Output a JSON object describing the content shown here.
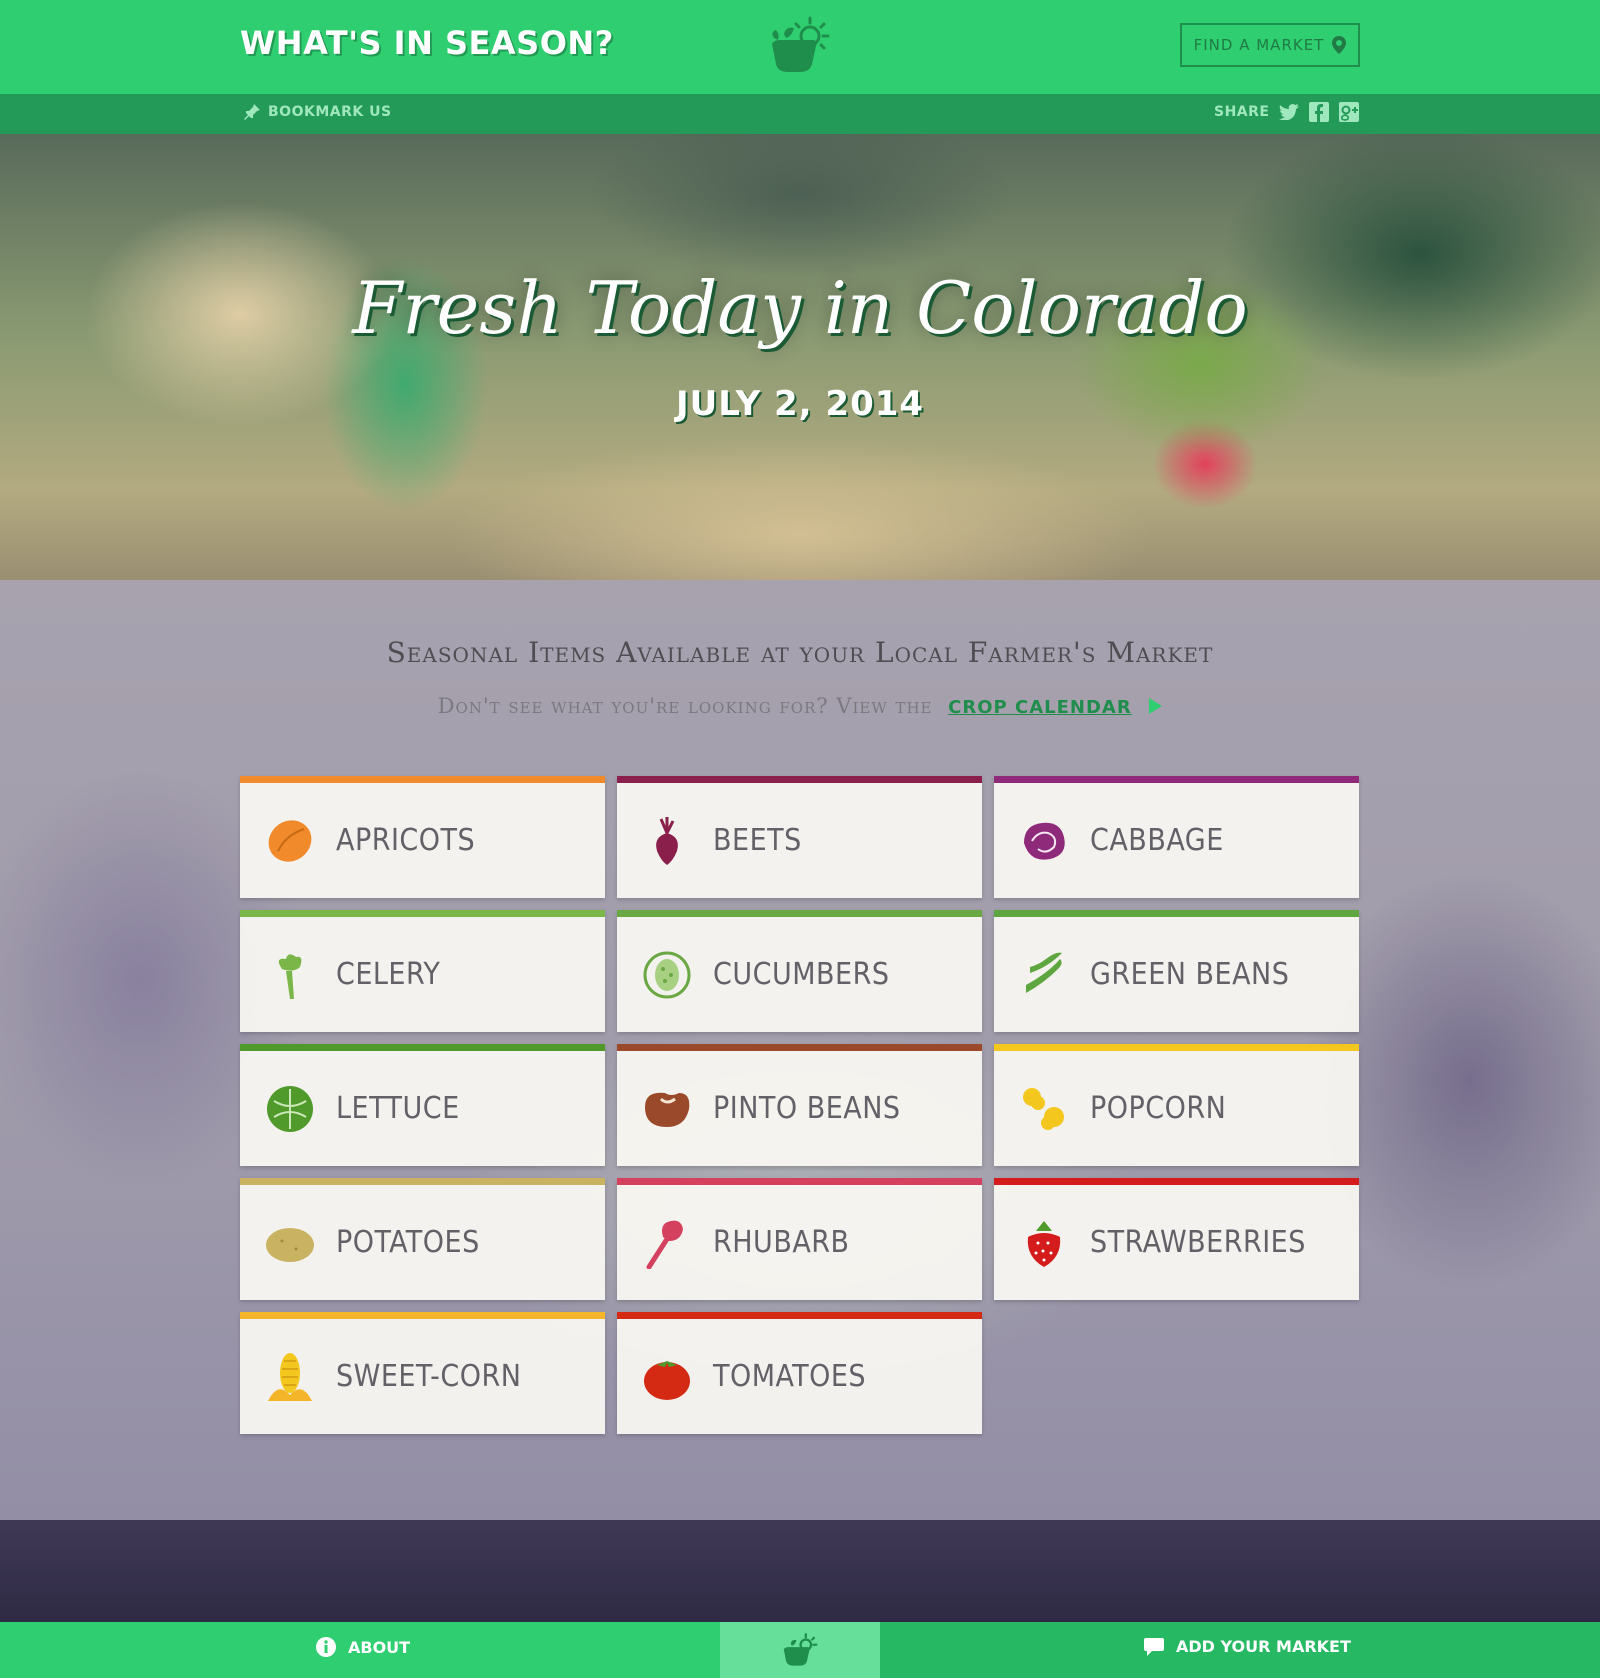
{
  "header": {
    "brand": "WHAT'S IN SEASON?",
    "find_market_label": "FIND A MARKET",
    "bookmark_label": "BOOKMARK US",
    "share_label": "SHARE"
  },
  "hero": {
    "title": "Fresh Today in Colorado",
    "date": "JULY 2, 2014"
  },
  "section": {
    "title": "Seasonal Items Available at your Local Farmer's Market",
    "subtitle": "Don't see what you're looking for? View the",
    "link_label": "CROP CALENDAR"
  },
  "items": [
    {
      "label": "APRICOTS",
      "color": "#f08a2a",
      "icon": "apricot-icon"
    },
    {
      "label": "BEETS",
      "color": "#8a1f4b",
      "icon": "beet-icon"
    },
    {
      "label": "CABBAGE",
      "color": "#8f2a7a",
      "icon": "cabbage-icon"
    },
    {
      "label": "CELERY",
      "color": "#7ab648",
      "icon": "celery-icon"
    },
    {
      "label": "CUCUMBERS",
      "color": "#6aa843",
      "icon": "cucumber-icon"
    },
    {
      "label": "GREEN BEANS",
      "color": "#5ea640",
      "icon": "green-beans-icon"
    },
    {
      "label": "LETTUCE",
      "color": "#4f9a2a",
      "icon": "lettuce-icon"
    },
    {
      "label": "PINTO BEANS",
      "color": "#9a4a2a",
      "icon": "pinto-beans-icon"
    },
    {
      "label": "POPCORN",
      "color": "#f4c71e",
      "icon": "popcorn-icon"
    },
    {
      "label": "POTATOES",
      "color": "#c9b262",
      "icon": "potato-icon"
    },
    {
      "label": "RHUBARB",
      "color": "#d4415f",
      "icon": "rhubarb-icon"
    },
    {
      "label": "STRAWBERRIES",
      "color": "#d41c1c",
      "icon": "strawberry-icon"
    },
    {
      "label": "SWEET-CORN",
      "color": "#f4b52a",
      "icon": "corn-icon"
    },
    {
      "label": "TOMATOES",
      "color": "#d42a14",
      "icon": "tomato-icon"
    }
  ],
  "footer": {
    "about_label": "ABOUT",
    "add_market_label": "ADD YOUR MARKET"
  },
  "colors": {
    "brand_green": "#2fce70",
    "dark_green": "#239a57",
    "text_gray": "#636167"
  }
}
